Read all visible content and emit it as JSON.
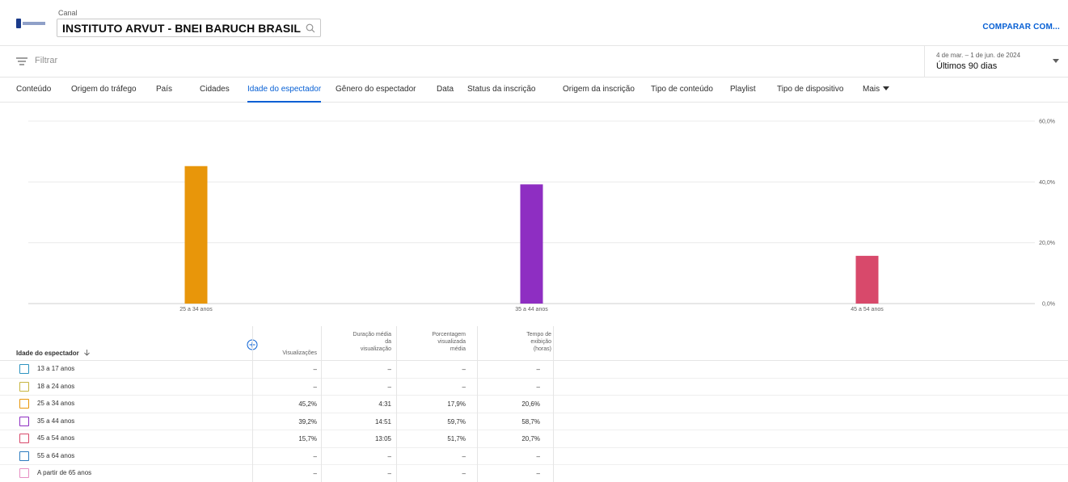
{
  "header": {
    "channel_label": "Canal",
    "channel_name": "INSTITUTO ARVUT - BNEI BARUCH BRASIL",
    "compare_label": "COMPARAR COM..."
  },
  "filter": {
    "placeholder": "Filtrar"
  },
  "date_range": {
    "sub": "4 de mar. – 1 de jun. de 2024",
    "main": "Últimos 90 dias"
  },
  "tabs": [
    {
      "label": "Conteúdo"
    },
    {
      "label": "Origem do tráfego"
    },
    {
      "label": "País"
    },
    {
      "label": "Cidades"
    },
    {
      "label": "Idade do espectador"
    },
    {
      "label": "Gênero do espectador"
    },
    {
      "label": "Data"
    },
    {
      "label": "Status da inscrição"
    },
    {
      "label": "Origem da inscrição"
    },
    {
      "label": "Tipo de conteúdo"
    },
    {
      "label": "Playlist"
    },
    {
      "label": "Tipo de dispositivo"
    },
    {
      "label": "Mais"
    }
  ],
  "active_tab": 4,
  "chart_data": {
    "type": "bar",
    "categories": [
      "25 a 34 anos",
      "35 a 44 anos",
      "45 a 54 anos"
    ],
    "values": [
      45.2,
      39.2,
      15.7
    ],
    "colors": [
      "#e8960a",
      "#8e2ec2",
      "#d8496b"
    ],
    "ylim": [
      0,
      60
    ],
    "yticks": [
      "0,0%",
      "20,0%",
      "40,0%",
      "60,0%"
    ],
    "ytick_values": [
      0,
      20,
      40,
      60
    ],
    "grid": true
  },
  "table": {
    "first_header": "Idade do espectador",
    "columns": [
      {
        "label": "Visualizações"
      },
      {
        "label": "Duração média da visualização"
      },
      {
        "label": "Porcentagem visualizada média"
      },
      {
        "label": "Tempo de exibição (horas)"
      }
    ],
    "rows": [
      {
        "label": "13 a 17 anos",
        "color": "#2c93c0",
        "cells": [
          "–",
          "–",
          "–",
          "–"
        ]
      },
      {
        "label": "18 a 24 anos",
        "color": "#c7b540",
        "cells": [
          "–",
          "–",
          "–",
          "–"
        ]
      },
      {
        "label": "25 a 34 anos",
        "color": "#e8960a",
        "cells": [
          "45,2%",
          "4:31",
          "17,9%",
          "20,6%"
        ]
      },
      {
        "label": "35 a 44 anos",
        "color": "#8e2ec2",
        "cells": [
          "39,2%",
          "14:51",
          "59,7%",
          "58,7%"
        ]
      },
      {
        "label": "45 a 54 anos",
        "color": "#d8496b",
        "cells": [
          "15,7%",
          "13:05",
          "51,7%",
          "20,7%"
        ]
      },
      {
        "label": "55 a 64 anos",
        "color": "#2c7bbf",
        "cells": [
          "–",
          "–",
          "–",
          "–"
        ]
      },
      {
        "label": "A partir de 65 anos",
        "color": "#e68fc3",
        "cells": [
          "–",
          "–",
          "–",
          "–"
        ]
      }
    ]
  }
}
